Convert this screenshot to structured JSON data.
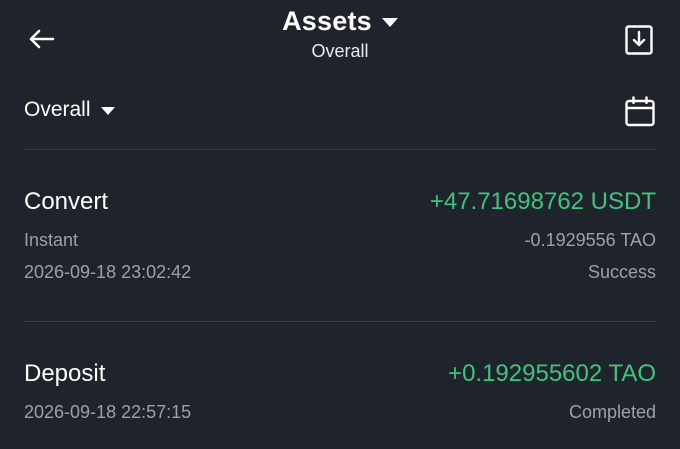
{
  "header": {
    "title": "Assets",
    "subtitle": "Overall"
  },
  "filter": {
    "label": "Overall"
  },
  "records": [
    {
      "type": "Convert",
      "amount": "+47.71698762 USDT",
      "method": "Instant",
      "secondary_amount": "-0.1929556 TAO",
      "timestamp": "2026-09-18 23:02:42",
      "status": "Success"
    },
    {
      "type": "Deposit",
      "amount": "+0.192955602 TAO",
      "timestamp": "2026-09-18 22:57:15",
      "status": "Completed"
    }
  ],
  "colors": {
    "background": "#1f242c",
    "positive": "#3ec47d",
    "muted": "#9aa1ab",
    "divider": "#353b44"
  }
}
